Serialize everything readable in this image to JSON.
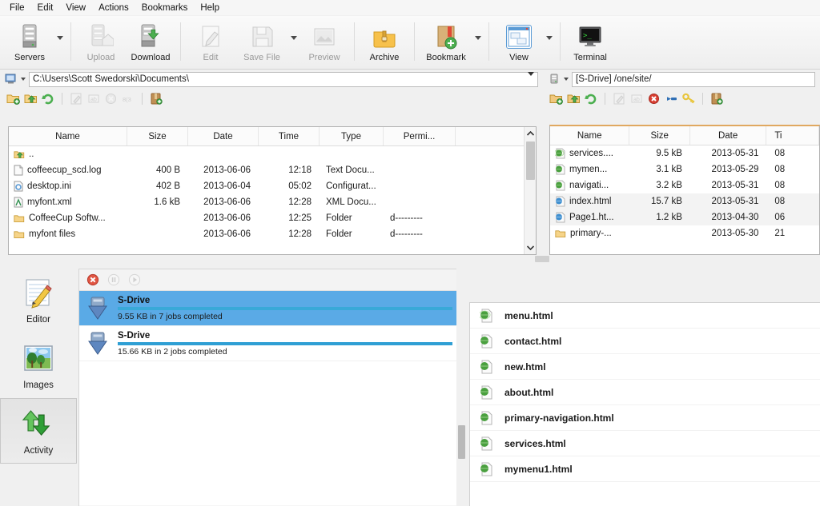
{
  "menubar": {
    "items": [
      {
        "label": "File"
      },
      {
        "label": "Edit"
      },
      {
        "label": "View"
      },
      {
        "label": "Actions"
      },
      {
        "label": "Bookmarks"
      },
      {
        "label": "Help"
      }
    ]
  },
  "toolbar": {
    "buttons": [
      {
        "label": "Servers",
        "icon": "server-icon",
        "enabled": true,
        "dropdown": true
      },
      {
        "label": "Upload",
        "icon": "upload-icon",
        "enabled": false,
        "dropdown": false
      },
      {
        "label": "Download",
        "icon": "download-icon",
        "enabled": true,
        "dropdown": false
      },
      {
        "label": "Edit",
        "icon": "edit-pencil-icon",
        "enabled": false,
        "dropdown": false
      },
      {
        "label": "Save File",
        "icon": "floppy-disk-icon",
        "enabled": false,
        "dropdown": true
      },
      {
        "label": "Preview",
        "icon": "preview-image-icon",
        "enabled": false,
        "dropdown": false
      },
      {
        "label": "Archive",
        "icon": "archive-icon",
        "enabled": true,
        "dropdown": false
      },
      {
        "label": "Bookmark",
        "icon": "bookmark-add-icon",
        "enabled": true,
        "dropdown": true
      },
      {
        "label": "View",
        "icon": "view-layout-icon",
        "enabled": true,
        "dropdown": true,
        "selected": true
      },
      {
        "label": "Terminal",
        "icon": "terminal-icon",
        "enabled": true,
        "dropdown": false
      }
    ]
  },
  "local": {
    "path": "C:\\Users\\Scott Swedorski\\Documents\\",
    "path_icon": "computer-icon",
    "mini_toolbar": [
      {
        "icon": "new-folder-icon",
        "enabled": true
      },
      {
        "icon": "parent-folder-icon",
        "enabled": true
      },
      {
        "icon": "refresh-icon",
        "enabled": true
      },
      {
        "icon": "edit-file-icon",
        "enabled": false
      },
      {
        "icon": "rename-icon",
        "enabled": false
      },
      {
        "icon": "delete-icon",
        "enabled": false
      },
      {
        "icon": "properties-icon",
        "enabled": false
      },
      {
        "icon": "archive-icon",
        "enabled": true
      }
    ],
    "columns": [
      "Name",
      "Size",
      "Date",
      "Time",
      "Type",
      "Permi..."
    ],
    "rows": [
      {
        "icon": "parent-folder-icon",
        "name": "..",
        "size": "",
        "date": "",
        "time": "",
        "type": "",
        "perm": ""
      },
      {
        "icon": "text-file-icon",
        "name": "coffeecup_scd.log",
        "size": "400 B",
        "date": "2013-06-06",
        "time": "12:18",
        "type": "Text Docu...",
        "perm": ""
      },
      {
        "icon": "config-file-icon",
        "name": "desktop.ini",
        "size": "402 B",
        "date": "2013-06-04",
        "time": "05:02",
        "type": "Configurat...",
        "perm": ""
      },
      {
        "icon": "xml-file-icon",
        "name": "myfont.xml",
        "size": "1.6 kB",
        "date": "2013-06-06",
        "time": "12:28",
        "type": "XML Docu...",
        "perm": ""
      },
      {
        "icon": "folder-icon",
        "name": "CoffeeCup Softw...",
        "size": "",
        "date": "2013-06-06",
        "time": "12:25",
        "type": "Folder",
        "perm": "d---------"
      },
      {
        "icon": "folder-icon",
        "name": "myfont files",
        "size": "",
        "date": "2013-06-06",
        "time": "12:28",
        "type": "Folder",
        "perm": "d---------"
      }
    ]
  },
  "remote": {
    "path": "[S-Drive] /one/site/",
    "path_icon": "server-small-icon",
    "mini_toolbar": [
      {
        "icon": "new-folder-icon",
        "enabled": true
      },
      {
        "icon": "parent-folder-icon",
        "enabled": true
      },
      {
        "icon": "refresh-icon",
        "enabled": true
      },
      {
        "icon": "edit-file-icon",
        "enabled": false
      },
      {
        "icon": "rename-icon",
        "enabled": false
      },
      {
        "icon": "delete-icon",
        "enabled": true
      },
      {
        "icon": "link-icon",
        "enabled": true
      },
      {
        "icon": "permissions-key-icon",
        "enabled": true
      },
      {
        "icon": "archive-icon",
        "enabled": true
      }
    ],
    "columns": [
      "Name",
      "Size",
      "Date",
      "Ti"
    ],
    "rows": [
      {
        "icon": "html-file-icon",
        "name": "services....",
        "size": "9.5 kB",
        "date": "2013-05-31",
        "time": "08",
        "selected": false
      },
      {
        "icon": "html-file-icon",
        "name": "mymen...",
        "size": "3.1 kB",
        "date": "2013-05-29",
        "time": "08",
        "selected": false
      },
      {
        "icon": "html-file-icon",
        "name": "navigati...",
        "size": "3.2 kB",
        "date": "2013-05-31",
        "time": "08",
        "selected": false
      },
      {
        "icon": "html-file-icon",
        "name": "index.html",
        "size": "15.7 kB",
        "date": "2013-05-31",
        "time": "08",
        "selected": true
      },
      {
        "icon": "html-file-icon",
        "name": "Page1.ht...",
        "size": "1.2 kB",
        "date": "2013-04-30",
        "time": "06",
        "selected": true
      },
      {
        "icon": "folder-icon",
        "name": "primary-...",
        "size": "",
        "date": "2013-05-30",
        "time": "21",
        "selected": false
      }
    ]
  },
  "sidebar": {
    "items": [
      {
        "label": "Editor",
        "icon": "editor-icon",
        "active": false
      },
      {
        "label": "Images",
        "icon": "images-icon",
        "active": false
      },
      {
        "label": "Activity",
        "icon": "activity-icon",
        "active": true
      }
    ]
  },
  "activity": {
    "controls": [
      {
        "icon": "cancel-icon",
        "enabled": true
      },
      {
        "icon": "pause-icon",
        "enabled": false
      },
      {
        "icon": "play-icon",
        "enabled": false
      }
    ],
    "transfers": [
      {
        "title": "S-Drive",
        "status": "9.55 KB in 7 jobs completed",
        "progress": 100,
        "selected": true,
        "icon": "download-arrow-icon"
      },
      {
        "title": "S-Drive",
        "status": "15.66 KB in 2 jobs completed",
        "progress": 100,
        "selected": false,
        "icon": "download-arrow-icon"
      }
    ]
  },
  "documents": {
    "files": [
      {
        "name": "menu.html",
        "icon": "html-file-icon"
      },
      {
        "name": "contact.html",
        "icon": "html-file-icon"
      },
      {
        "name": "new.html",
        "icon": "html-file-icon"
      },
      {
        "name": "about.html",
        "icon": "html-file-icon"
      },
      {
        "name": "primary-navigation.html",
        "icon": "html-file-icon"
      },
      {
        "name": "services.html",
        "icon": "html-file-icon"
      },
      {
        "name": "mymenu1.html",
        "icon": "html-file-icon"
      }
    ]
  },
  "colors": {
    "accent_blue": "#5aaae6",
    "progress_blue": "#2f9fd4",
    "selection_grey": "#f3f3f3",
    "remote_top_border": "#e0a860",
    "window_bg": "#f0f0f0"
  }
}
